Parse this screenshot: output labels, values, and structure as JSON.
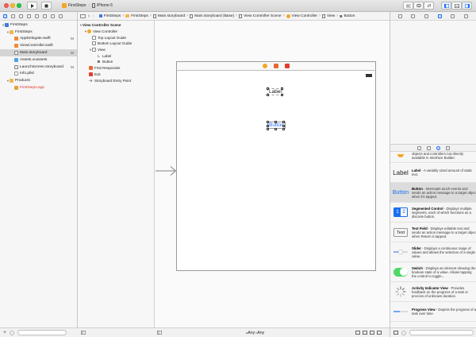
{
  "toolbar": {
    "scheme_target": "FirstSteps",
    "scheme_device": "iPhone 6"
  },
  "jump_bar": {
    "crumbs": [
      "FirstSteps",
      "FirstSteps",
      "Main.storyboard",
      "Main.storyboard (Base)",
      "View Controller Scene",
      "View Controller",
      "View",
      "Button"
    ]
  },
  "navigator": {
    "items": [
      {
        "label": "FirstSteps",
        "badge": ""
      },
      {
        "label": "FirstSteps",
        "badge": ""
      },
      {
        "label": "AppDelegate.swift",
        "badge": "M"
      },
      {
        "label": "ViewController.swift",
        "badge": ""
      },
      {
        "label": "Main.storyboard",
        "badge": "M"
      },
      {
        "label": "Assets.xcassets",
        "badge": ""
      },
      {
        "label": "LaunchScreen.storyboard",
        "badge": "M"
      },
      {
        "label": "Info.plist",
        "badge": ""
      },
      {
        "label": "Products",
        "badge": ""
      },
      {
        "label": "FirstSteps.app",
        "badge": ""
      }
    ]
  },
  "outline": {
    "items": [
      "View Controller Scene",
      "View Controller",
      "Top Layout Guide",
      "Bottom Layout Guide",
      "View",
      "Label",
      "Button",
      "First Responder",
      "Exit",
      "Storyboard Entry Point"
    ],
    "label_glyph": "L",
    "button_glyph": "B"
  },
  "canvas": {
    "label_text": "Label",
    "button_text": "Button",
    "size_w": "Any",
    "size_h": "Any",
    "size_sep": "w",
    "size_sep2": "h"
  },
  "library": {
    "items": [
      {
        "title": "",
        "desc": "objects and controllers not directly available in Interface Builder.",
        "thumb": ""
      },
      {
        "title": "Label",
        "desc": " - A variably sized amount of static text.",
        "thumb": "Label"
      },
      {
        "title": "Button",
        "desc": " - Intercepts touch events and sends an action message to a target object when it's tapped.",
        "thumb": "Button"
      },
      {
        "title": "Segmented Control",
        "desc": " - Displays multiple segments, each of which functions as a discrete button.",
        "thumb": "12"
      },
      {
        "title": "Text Field",
        "desc": " - Displays editable text and sends an action message to a target object when Return is tapped.",
        "thumb": "Text"
      },
      {
        "title": "Slider",
        "desc": " - Displays a continuous range of values and allows the selection of a single value.",
        "thumb": ""
      },
      {
        "title": "Switch",
        "desc": " - Displays an element showing the boolean state of a value. Allows tapping the control to toggle...",
        "thumb": ""
      },
      {
        "title": "Activity Indicator View",
        "desc": " - Provides feedback on the progress of a task or process of unknown duration.",
        "thumb": ""
      },
      {
        "title": "Progress View",
        "desc": " - Depicts the progress of a task over time.",
        "thumb": ""
      }
    ]
  },
  "colors": {
    "accent": "#1c6ef2",
    "folder": "#f2b84b",
    "red_file": "#e0352b"
  }
}
